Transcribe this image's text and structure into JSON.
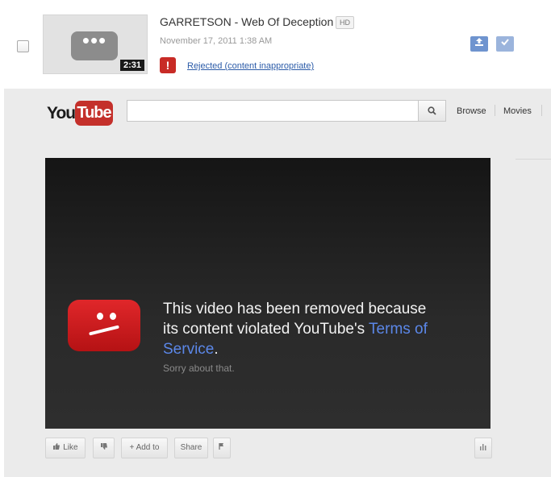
{
  "upload": {
    "title": "GARRETSON - Web Of Deception",
    "hd_badge": "HD",
    "date": "November 17, 2011 1:38 AM",
    "status": "Rejected (content inappropriate)",
    "duration": "2:31",
    "thumb_dots": "•••",
    "alert_glyph": "!",
    "action_icons": [
      "upload-icon",
      "check-icon"
    ]
  },
  "youtube": {
    "logo_you": "You",
    "logo_tube": "Tube",
    "search_placeholder": "",
    "nav": {
      "browse": "Browse",
      "movies": "Movies"
    }
  },
  "player": {
    "message_line1": "This video has been removed because",
    "message_line2": "its content violated YouTube's",
    "tos_text": "Terms of Service",
    "period": ".",
    "sorry": "Sorry about that."
  },
  "actions": {
    "like": "Like",
    "add_to": "+ Add to",
    "share": "Share"
  },
  "colors": {
    "accent_blue": "#6f94cf",
    "youtube_red": "#c4302b",
    "alert_red": "#c82b26",
    "link_blue": "#2b5ba8",
    "tos_blue": "#5b87e8"
  }
}
